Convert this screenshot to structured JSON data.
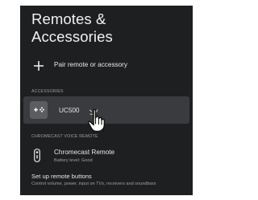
{
  "page": {
    "title": "Remotes & Accessories"
  },
  "actions": {
    "pair_label": "Pair remote or accessory"
  },
  "accessories": {
    "header": "ACCESSORIES",
    "items": [
      {
        "name": "UC500",
        "icon": "gamepad-icon"
      }
    ]
  },
  "chromecast_remote": {
    "header": "CHROMECAST VOICE REMOTE",
    "name": "Chromecast Remote",
    "status": "Battery level: Good",
    "icon": "remote-icon"
  },
  "setup_buttons": {
    "title": "Set up remote buttons",
    "description": "Control volume, power, input on TVs, receivers and soundbars"
  },
  "theme": {
    "background": "#1e1f21",
    "card": "#3a3b3e",
    "text_primary": "#e8e8e8",
    "text_secondary": "#9aa0a6"
  }
}
